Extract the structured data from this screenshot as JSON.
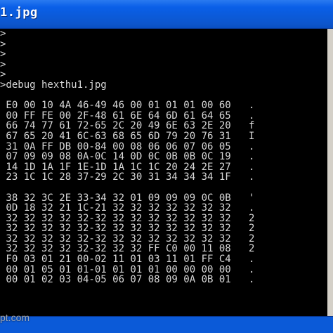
{
  "window": {
    "title": "1.jpg"
  },
  "console": {
    "lines": [
      ">",
      ">",
      ">",
      ">",
      ">",
      ">debug hexthu1.jpg",
      "",
      " E0 00 10 4A 46-49 46 00 01 01 01 00 60   .",
      " 00 FF FE 00 2F-48 61 6E 64 6D 61 64 65   .",
      " 66 74 77 61 72-65 2C 20 49 6E 63 2E 20   f",
      " 67 65 20 41 6C-63 68 65 6D 79 20 76 31   I",
      " 31 0A FF DB 00-84 00 08 06 06 07 06 05   .",
      " 07 09 09 08 0A-0C 14 0D 0C 0B 0B 0C 19   .",
      " 14 1D 1A 1F 1E-1D 1A 1C 1C 20 24 2E 27   .",
      " 23 1C 1C 28 37-29 2C 30 31 34 34 34 1F   .",
      "",
      " 38 32 3C 2E 33-34 32 01 09 09 09 0C 0B   '",
      " 0D 18 32 21 1C-21 32 32 32 32 32 32 32   .",
      " 32 32 32 32 32-32 32 32 32 32 32 32 32   2",
      " 32 32 32 32 32-32 32 32 32 32 32 32 32   2",
      " 32 32 32 32 32-32 32 32 32 32 32 32 32   2",
      " 32 32 32 32 32-32 32 32 FF C0 00 11 08   2",
      " F0 03 01 21 00-02 11 01 03 11 01 FF C4   .",
      " 00 01 05 01 01-01 01 01 01 00 00 00 00   .",
      " 00 01 02 03 04-05 06 07 08 09 0A 0B 01   ."
    ]
  },
  "watermark": {
    "text": "pt.com"
  }
}
